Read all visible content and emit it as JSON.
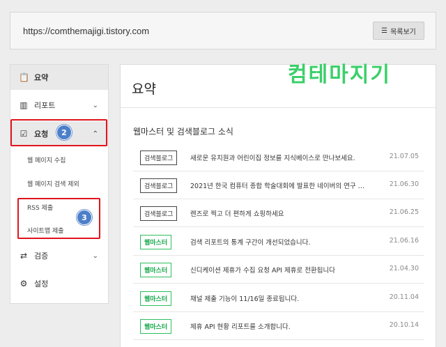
{
  "address_bar": {
    "url": "https://comthemajigi.tistory.com",
    "list_button_label": "목록보기"
  },
  "sidebar": {
    "items": [
      {
        "label": "요약",
        "icon": "clipboard-icon"
      },
      {
        "label": "리포트",
        "icon": "bar-chart-icon"
      },
      {
        "label": "요청",
        "icon": "check-square-icon"
      },
      {
        "label": "검증",
        "icon": "swap-icon"
      },
      {
        "label": "설정",
        "icon": "gear-icon"
      }
    ],
    "request_subitems": [
      "웹 페이지 수집",
      "웹 페이지 검색 제외",
      "RSS 제출",
      "사이트맵 제출"
    ]
  },
  "annotations": {
    "badge_2": "2",
    "badge_3": "3",
    "highlight_color": "#e0141b",
    "badge_color": "#4d7fc9"
  },
  "main": {
    "title": "요약",
    "section_title": "웹마스터 및 검색블로그 소식",
    "news": [
      {
        "tag": "검색블로그",
        "text": "새로운 유치원과 어린이집 정보를 지식베이스로 만나보세요.",
        "date": "21.07.05",
        "tag_type": "blog"
      },
      {
        "tag": "검색블로그",
        "text": "2021년 한국 컴퓨터 종합 학술대회에 발표한 네이버의 연구 …",
        "date": "21.06.30",
        "tag_type": "blog"
      },
      {
        "tag": "검색블로그",
        "text": "렌즈로 찍고 더 편하게 쇼핑하세요",
        "date": "21.06.25",
        "tag_type": "blog"
      },
      {
        "tag": "웹마스터",
        "text": "검색 리포트의 통계 구간이 개선되었습니다.",
        "date": "21.06.16",
        "tag_type": "webmaster"
      },
      {
        "tag": "웹마스터",
        "text": "신디케이션 제휴가 수집 요청 API 제휴로 전환됩니다",
        "date": "21.04.30",
        "tag_type": "webmaster"
      },
      {
        "tag": "웹마스터",
        "text": "채널 제출 기능이 11/16일 종료됩니다.",
        "date": "20.11.04",
        "tag_type": "webmaster"
      },
      {
        "tag": "웹마스터",
        "text": "제휴 API 현황 리포트를 소개합니다.",
        "date": "20.10.14",
        "tag_type": "webmaster"
      }
    ]
  },
  "watermark": {
    "text": "컴테마지기",
    "color": "#3bd06a"
  }
}
